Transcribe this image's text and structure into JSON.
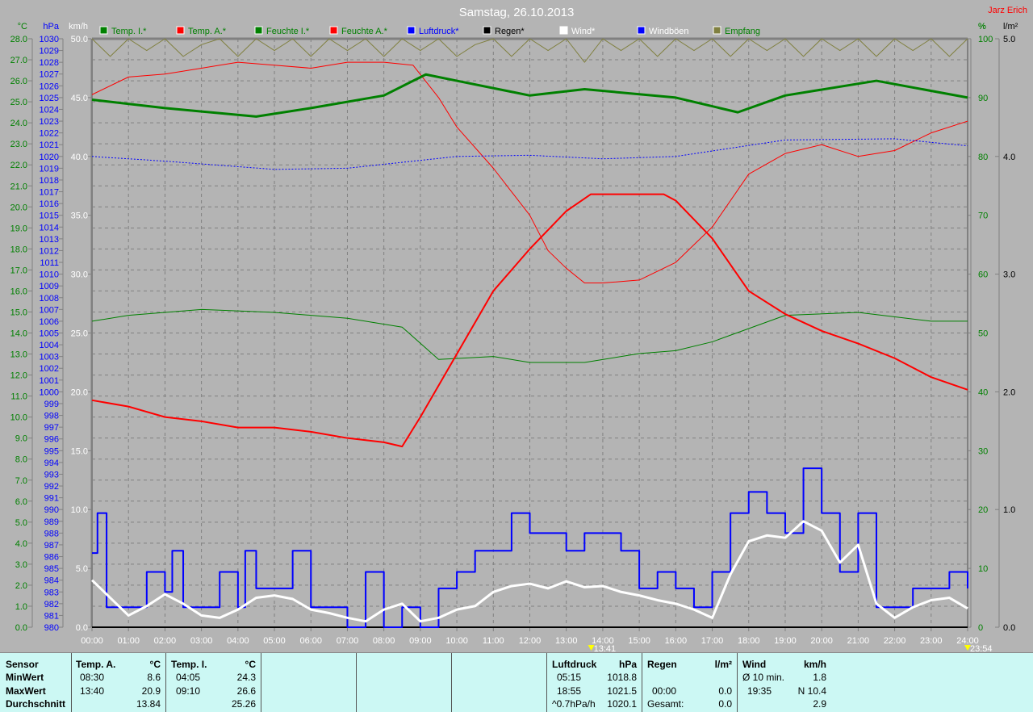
{
  "title": "Samstag, 26.10.2013",
  "author": "Jarz Erich",
  "legend": [
    {
      "label": "Temp. I.*",
      "color": "#008000",
      "text_color": "#008000"
    },
    {
      "label": "Temp. A.*",
      "color": "#ff0000",
      "text_color": "#008000"
    },
    {
      "label": "Feuchte I.*",
      "color": "#008000",
      "text_color": "#008000"
    },
    {
      "label": "Feuchte A.*",
      "color": "#ff0000",
      "text_color": "#008000"
    },
    {
      "label": "Luftdruck*",
      "color": "#0000ff",
      "text_color": "#0000ff"
    },
    {
      "label": "Regen*",
      "color": "#000000",
      "text_color": "#000000"
    },
    {
      "label": "Wind*",
      "color": "#ffffff",
      "text_color": "#ffffff"
    },
    {
      "label": "Windböen",
      "color": "#0000ff",
      "text_color": "#ffffff"
    },
    {
      "label": "Empfang",
      "color": "#808040",
      "text_color": "#008000"
    }
  ],
  "markers": [
    {
      "time": "13:41",
      "x": 13.683
    },
    {
      "time": "23:54",
      "x": 24
    }
  ],
  "chart_data": {
    "type": "line",
    "title": "Samstag, 26.10.2013",
    "xlim": [
      0,
      24
    ],
    "x_ticks": [
      "00:00",
      "01:00",
      "02:00",
      "03:00",
      "04:00",
      "05:00",
      "06:00",
      "07:00",
      "08:00",
      "09:00",
      "10:00",
      "11:00",
      "12:00",
      "13:00",
      "14:00",
      "15:00",
      "16:00",
      "17:00",
      "18:00",
      "19:00",
      "20:00",
      "21:00",
      "22:00",
      "23:00",
      "24:00"
    ],
    "axes": {
      "temp": {
        "label": "°C",
        "range": [
          0,
          28
        ],
        "step": 1,
        "color": "#008000"
      },
      "pressure": {
        "label": "hPa",
        "range": [
          980,
          1030
        ],
        "step": 1,
        "color": "#0000ff"
      },
      "wind": {
        "label": "km/h",
        "range": [
          0,
          50
        ],
        "step": 5,
        "color": "#ffffff"
      },
      "humidity": {
        "label": "%",
        "range": [
          0,
          100
        ],
        "step": 10,
        "color": "#008000"
      },
      "rain": {
        "label": "l/m²",
        "range": [
          0,
          5
        ],
        "step": 1,
        "color": "#000000"
      }
    },
    "grid": true,
    "series": [
      {
        "name": "Temp. A.*",
        "axis": "temp",
        "color": "#ff0000",
        "width": 2,
        "x": [
          0,
          1,
          2,
          3,
          4,
          5,
          6,
          7,
          8,
          8.5,
          9,
          10,
          11,
          12,
          13,
          13.67,
          14,
          15,
          15.67,
          16,
          17,
          18,
          19,
          20,
          21,
          22,
          23,
          24
        ],
        "y": [
          10.8,
          10.5,
          10.0,
          9.8,
          9.5,
          9.5,
          9.3,
          9.0,
          8.8,
          8.6,
          10.0,
          13.0,
          16.0,
          18.0,
          19.8,
          20.6,
          20.6,
          20.6,
          20.6,
          20.3,
          18.5,
          16.0,
          14.9,
          14.1,
          13.5,
          12.8,
          11.9,
          11.3
        ]
      },
      {
        "name": "Temp. I.*",
        "axis": "temp",
        "color": "#008000",
        "width": 3,
        "x": [
          0,
          2,
          4.5,
          6,
          8,
          9.15,
          10,
          12,
          13.5,
          16,
          17.7,
          19,
          21.5,
          24
        ],
        "y": [
          25.1,
          24.7,
          24.3,
          24.7,
          25.3,
          26.3,
          26.0,
          25.3,
          25.6,
          25.2,
          24.5,
          25.3,
          26.0,
          25.2
        ]
      },
      {
        "name": "Feuchte A.*",
        "axis": "humidity",
        "color": "#ff0000",
        "width": 1,
        "x": [
          0,
          1,
          2,
          3,
          4,
          5,
          6,
          7,
          8,
          8.8,
          9.5,
          10,
          11,
          12,
          12.5,
          13,
          13.5,
          14,
          15,
          16,
          17,
          18,
          19,
          20,
          21,
          22,
          23,
          24
        ],
        "y": [
          90.5,
          93.5,
          94,
          95,
          96,
          95.5,
          95,
          96,
          96,
          95.5,
          90,
          85,
          78,
          70,
          64,
          61,
          58.5,
          58.5,
          59,
          62,
          68,
          77,
          80.5,
          82,
          80,
          81,
          84,
          86
        ]
      },
      {
        "name": "Feuchte I.*",
        "axis": "humidity",
        "color": "#008000",
        "width": 1,
        "x": [
          0,
          1,
          3,
          5,
          7,
          8.5,
          9.5,
          11,
          12,
          13.5,
          15,
          16,
          17,
          19,
          21,
          23,
          24
        ],
        "y": [
          52,
          53,
          54,
          53.5,
          52.5,
          51,
          45.5,
          46,
          45,
          45,
          46.5,
          47,
          48.5,
          53,
          53.5,
          52,
          52
        ]
      },
      {
        "name": "Luftdruck*",
        "axis": "pressure",
        "color": "#0000ff",
        "width": 1,
        "dash": "2,2",
        "x": [
          0,
          2,
          5,
          7,
          10,
          12,
          14,
          16,
          19,
          22,
          24
        ],
        "y": [
          1020.0,
          1019.6,
          1018.9,
          1019.0,
          1020.0,
          1020.1,
          1019.8,
          1020.0,
          1021.4,
          1021.5,
          1020.9
        ]
      },
      {
        "name": "Regen*",
        "axis": "rain",
        "color": "#000000",
        "width": 2,
        "x": [
          0,
          24
        ],
        "y": [
          0,
          0
        ]
      },
      {
        "name": "Windböen",
        "axis": "wind",
        "color": "#0000ff",
        "width": 2,
        "step": true,
        "x": [
          0,
          0.15,
          0.4,
          1,
          1.5,
          2,
          2.2,
          2.5,
          3,
          3.5,
          4,
          4.2,
          4.5,
          5,
          5.5,
          6,
          6.5,
          7,
          7.5,
          8,
          8.5,
          9,
          9.5,
          10,
          10.5,
          11,
          11.5,
          12,
          12.5,
          13,
          13.5,
          14,
          14.5,
          15,
          15.5,
          16,
          16.5,
          17,
          17.5,
          18,
          18.5,
          19,
          19.5,
          20,
          20.5,
          21,
          21.5,
          22,
          22.5,
          23,
          23.5,
          24
        ],
        "y": [
          6.3,
          9.7,
          1.7,
          1.7,
          4.7,
          3,
          6.5,
          1.7,
          1.7,
          4.7,
          1.7,
          6.5,
          3.3,
          3.3,
          6.5,
          1.7,
          1.7,
          0,
          4.7,
          0,
          1.7,
          0,
          3.3,
          4.7,
          6.5,
          6.5,
          9.7,
          8,
          8,
          6.5,
          8,
          8,
          6.5,
          3.3,
          4.7,
          3.3,
          1.7,
          4.7,
          9.7,
          11.5,
          9.7,
          8,
          13.5,
          9.7,
          4.7,
          9.7,
          1.7,
          1.7,
          3.3,
          3.3,
          4.7,
          3.3
        ]
      },
      {
        "name": "Wind*",
        "axis": "wind",
        "color": "#ffffff",
        "width": 3,
        "x": [
          0,
          0.5,
          1,
          1.5,
          2,
          2.5,
          3,
          3.5,
          4,
          4.5,
          5,
          5.5,
          6,
          6.5,
          7,
          7.5,
          8,
          8.5,
          9,
          9.5,
          10,
          10.5,
          11,
          11.5,
          12,
          12.5,
          13,
          13.5,
          14,
          14.5,
          15,
          15.5,
          16,
          16.5,
          17,
          17.5,
          18,
          18.5,
          19,
          19.5,
          20,
          20.5,
          21,
          21.5,
          22,
          22.5,
          23,
          23.5,
          24
        ],
        "y": [
          4,
          2.5,
          1,
          1.8,
          2.8,
          2,
          1,
          0.8,
          1.5,
          2.5,
          2.7,
          2.4,
          1.5,
          1.2,
          0.8,
          0.5,
          1.5,
          2,
          0.5,
          0.8,
          1.5,
          1.8,
          3,
          3.5,
          3.7,
          3.3,
          3.9,
          3.4,
          3.5,
          3,
          2.7,
          2.3,
          2,
          1.5,
          0.8,
          4.5,
          7.3,
          7.8,
          7.6,
          9,
          8.2,
          5.5,
          7,
          2,
          0.8,
          1.7,
          2.3,
          2.5,
          1.6
        ]
      },
      {
        "name": "Empfang",
        "axis": "humidity",
        "color": "#808040",
        "width": 1,
        "x": [
          0,
          0.5,
          1,
          1.5,
          2,
          2.5,
          3,
          3.5,
          4,
          4.5,
          5,
          5.5,
          6,
          6.5,
          7,
          7.5,
          8,
          8.5,
          9,
          9.5,
          10,
          10.5,
          11,
          11.5,
          12,
          12.5,
          13,
          13.5,
          14,
          14.5,
          15,
          15.5,
          16,
          16.5,
          17,
          17.5,
          18,
          18.5,
          19,
          19.5,
          20,
          20.5,
          21,
          21.5,
          22,
          22.5,
          23,
          23.5,
          24
        ],
        "y": [
          100,
          97,
          100,
          98,
          100,
          97,
          99,
          100,
          97,
          100,
          98,
          100,
          97,
          100,
          98,
          100,
          97,
          100,
          98,
          100,
          97,
          99,
          100,
          97,
          100,
          98,
          100,
          96,
          100,
          98,
          100,
          97,
          100,
          98,
          100,
          97,
          100,
          98,
          100,
          97,
          100,
          98,
          100,
          97,
          100,
          98,
          100,
          97,
          100
        ]
      }
    ]
  },
  "table": {
    "sensor": {
      "h": "Sensor",
      "min": "MinWert",
      "max": "MaxWert",
      "avg": "Durchschnitt"
    },
    "tempA": {
      "h": "Temp. A.",
      "u": "°C",
      "min_t": "08:30",
      "min": "8.6",
      "max_t": "13:40",
      "max": "20.9",
      "avg": "13.84"
    },
    "tempI": {
      "h": "Temp. I.",
      "u": "°C",
      "min_t": "04:05",
      "min": "24.3",
      "max_t": "09:10",
      "max": "26.6",
      "avg": "25.26"
    },
    "press": {
      "h": "Luftdruck",
      "u": "hPa",
      "min_t": "05:15",
      "min": "1018.8",
      "max_t": "18:55",
      "max": "1021.5",
      "trend": "^0.7hPa/h",
      "avg": "1020.1"
    },
    "rain": {
      "h": "Regen",
      "u": "l/m²",
      "max_t": "00:00",
      "max": "0.0",
      "tot_l": "Gesamt:",
      "tot": "0.0"
    },
    "wind": {
      "h": "Wind",
      "u": "km/h",
      "a_l": "Ø 10 min.",
      "a": "1.8",
      "max_t": "19:35",
      "max": "N 10.4",
      "avg": "2.9"
    }
  }
}
